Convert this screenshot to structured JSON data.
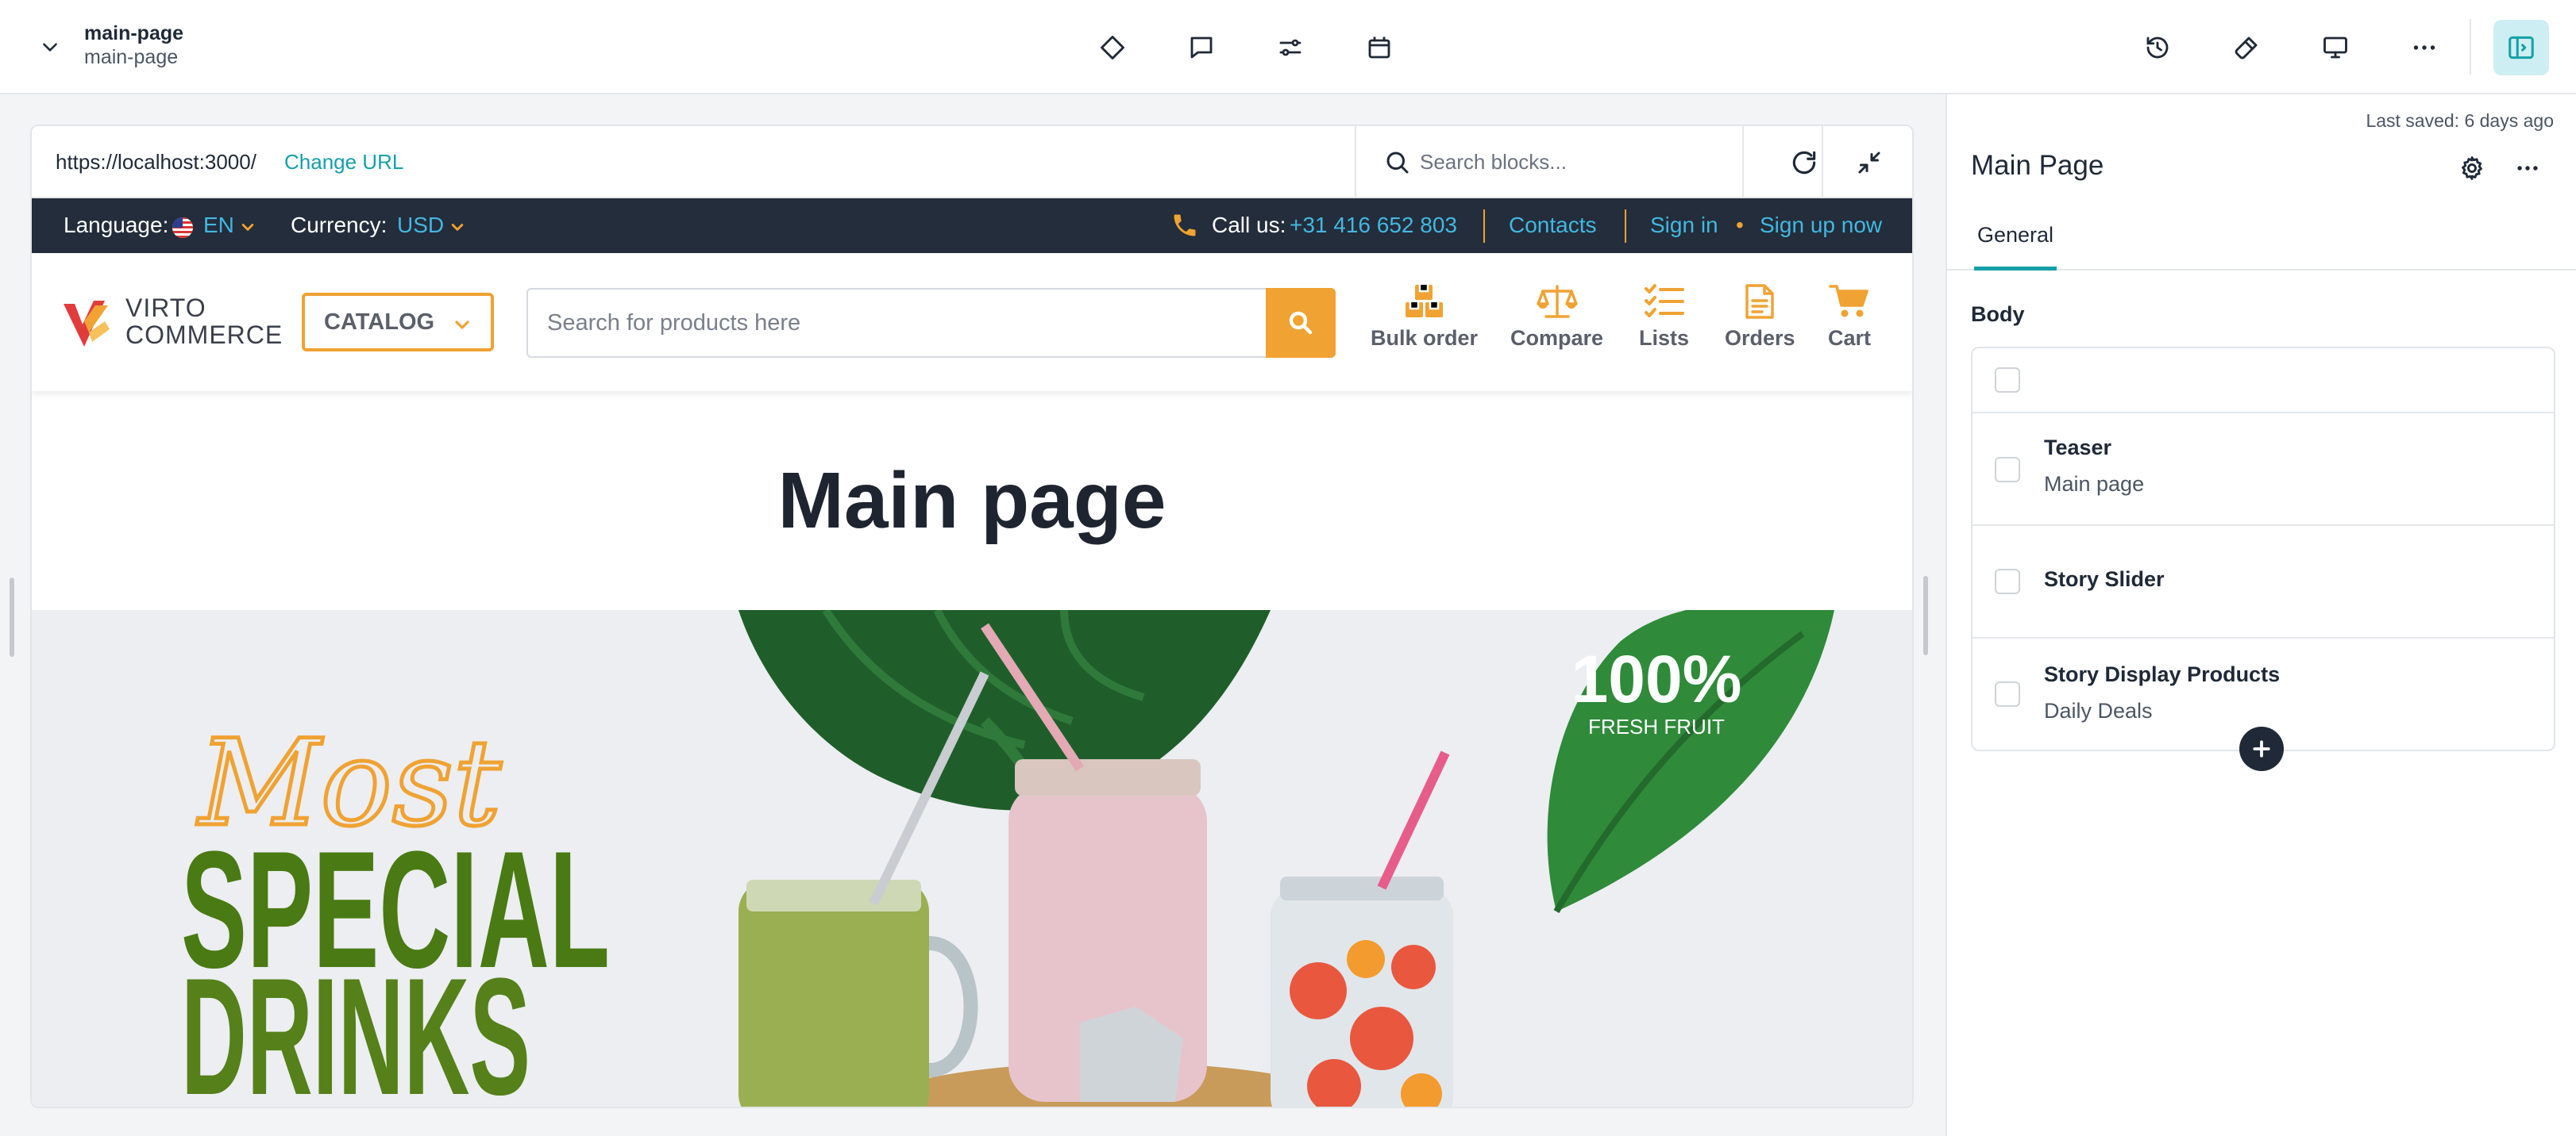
{
  "header": {
    "page_title": "main-page",
    "page_subtitle": "main-page",
    "toolbar_icons": [
      "chevron-down-icon",
      "diamond-icon",
      "comment-icon",
      "sliders-icon",
      "calendar-icon",
      "history-icon",
      "hammer-icon",
      "monitor-icon",
      "more-icon",
      "panel-toggle-icon"
    ]
  },
  "preview": {
    "url": "https://localhost:3000/",
    "change_url_label": "Change URL",
    "search_placeholder": "Search blocks..."
  },
  "site": {
    "language_label": "Language:",
    "language_value": "EN",
    "currency_label": "Currency:",
    "currency_value": "USD",
    "call_label": "Call us:",
    "phone": "+31 416 652 803",
    "contacts": "Contacts",
    "sign_in": "Sign in",
    "dot": "•",
    "sign_up": "Sign up now",
    "logo_line1": "VIRTO",
    "logo_line2": "COMMERCE",
    "catalog": "CATALOG",
    "search_placeholder": "Search for products here",
    "nav": {
      "bulk_order": "Bulk order",
      "compare": "Compare",
      "lists": "Lists",
      "orders": "Orders",
      "cart": "Cart"
    },
    "main_heading": "Main page",
    "hero": {
      "script_word": "Most",
      "line1": "SPECIAL",
      "line2": "DRINKS",
      "badge_big": "100%",
      "badge_small": "FRESH FRUIT"
    }
  },
  "panel": {
    "last_saved": "Last saved: 6 days ago",
    "title": "Main Page",
    "tab_general": "General",
    "body_label": "Body",
    "blocks": [
      {
        "name": "Teaser",
        "subtitle": "Main page"
      },
      {
        "name": "Story Slider",
        "subtitle": ""
      },
      {
        "name": "Story Display Products",
        "subtitle": "Daily Deals"
      }
    ]
  },
  "colors": {
    "accent": "#15a0a8",
    "site_orange": "#f0a232",
    "site_blue": "#43b7e0",
    "site_dark": "#232d3b"
  }
}
